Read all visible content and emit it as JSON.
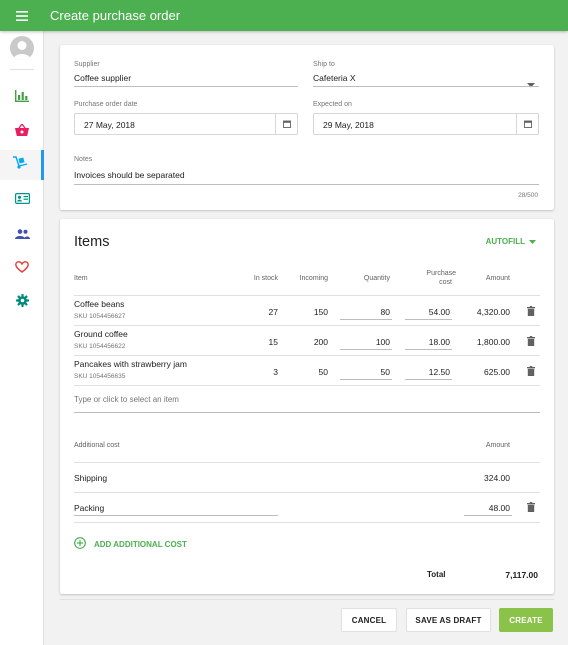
{
  "appbar": {
    "title": "Create purchase order"
  },
  "form": {
    "supplier_label": "Supplier",
    "supplier_value": "Coffee supplier",
    "ship_to_label": "Ship to",
    "ship_to_value": "Cafeteria X",
    "po_date_label": "Purchase order date",
    "po_date_value": "27 May, 2018",
    "expected_label": "Expected on",
    "expected_value": "29 May, 2018",
    "notes_label": "Notes",
    "notes_value": "Invoices should be separated",
    "notes_counter": "28/500"
  },
  "items": {
    "title": "Items",
    "autofill_label": "AUTOFILL",
    "columns": {
      "item": "Item",
      "in_stock": "In stock",
      "incoming": "Incoming",
      "quantity": "Quantity",
      "purchase_cost_1": "Purchase",
      "purchase_cost_2": "cost",
      "amount": "Amount"
    },
    "rows": [
      {
        "name": "Coffee beans",
        "sku": "SKU 1054456627",
        "in_stock": "27",
        "incoming": "150",
        "quantity": "80",
        "cost": "54.00",
        "amount": "4,320.00"
      },
      {
        "name": "Ground coffee",
        "sku": "SKU 1054456622",
        "in_stock": "15",
        "incoming": "200",
        "quantity": "100",
        "cost": "18.00",
        "amount": "1,800.00"
      },
      {
        "name": "Pancakes with strawberry jam",
        "sku": "SKU 1054456635",
        "in_stock": "3",
        "incoming": "50",
        "quantity": "50",
        "cost": "12.50",
        "amount": "625.00"
      }
    ],
    "add_item_placeholder": "Type or click to select an item"
  },
  "additional": {
    "header": "Additional cost",
    "amount_header": "Amount",
    "rows": [
      {
        "name": "Shipping",
        "amount": "324.00"
      },
      {
        "name": "Packing",
        "amount": "48.00"
      }
    ],
    "add_label": "ADD ADDITIONAL COST"
  },
  "totals": {
    "label": "Total",
    "value": "7,117.00"
  },
  "actions": {
    "cancel": "CANCEL",
    "save_draft": "SAVE AS DRAFT",
    "create": "CREATE"
  },
  "icons": {
    "menu": "menu-icon",
    "avatar": "avatar-icon",
    "reports": "bar-chart-icon",
    "sales": "basket-icon",
    "inventory": "dolly-icon",
    "customers": "id-card-icon",
    "employees": "people-icon",
    "loyalty": "heart-icon",
    "settings": "gear-icon",
    "calendar": "calendar-icon",
    "delete": "trash-icon",
    "add": "add-circle-icon",
    "dropdown": "caret-down-icon"
  },
  "colors": {
    "primary": "#4caf50",
    "create_button": "#8bc34a",
    "active_nav": "#2196f3",
    "nav_reports": "#43a047",
    "nav_sales": "#e91e63",
    "nav_inventory": "#03a9f4",
    "nav_customers": "#009688",
    "nav_employees": "#3f51b5",
    "nav_loyalty": "#e53935",
    "nav_settings": "#00897b"
  }
}
